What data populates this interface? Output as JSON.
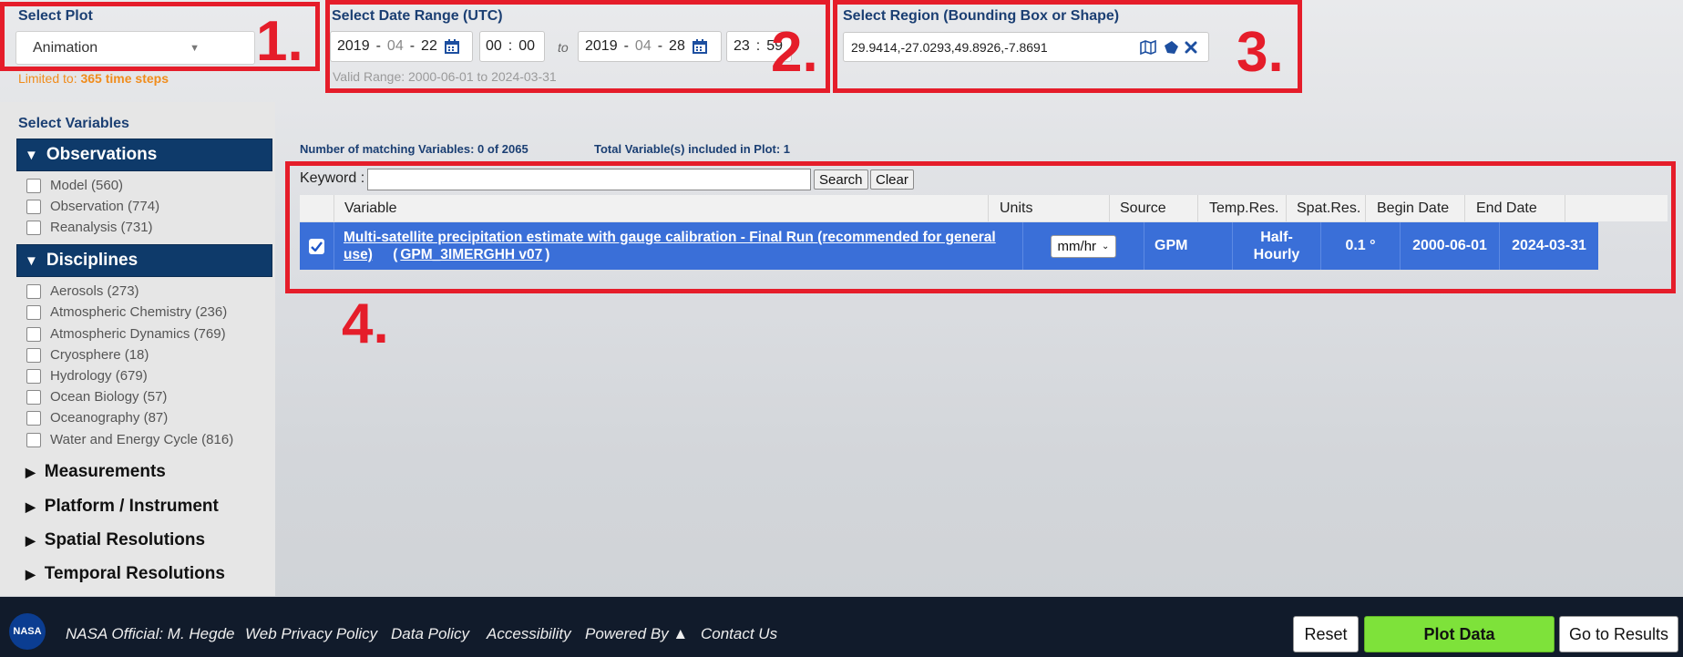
{
  "plot": {
    "section_title": "Select Plot",
    "selected": "Animation",
    "limit_prefix": "Limited to: ",
    "limit_value": "365 time steps"
  },
  "date_range": {
    "section_title": "Select Date Range (UTC)",
    "start_year": "2019",
    "start_month": "04",
    "start_day": "22",
    "start_hour": "00",
    "start_min": "00",
    "to_label": "to",
    "end_year": "2019",
    "end_month": "04",
    "end_day": "28",
    "end_hour": "23",
    "end_min": "59",
    "valid_range": "Valid Range: 2000-06-01 to 2024-03-31"
  },
  "region": {
    "section_title": "Select Region (Bounding Box or Shape)",
    "value": "29.9414,-27.0293,49.8926,-7.8691"
  },
  "annotations": {
    "n1": "1.",
    "n2": "2.",
    "n3": "3.",
    "n4": "4."
  },
  "variables": {
    "section_title": "Select Variables",
    "observations": {
      "header": "Observations",
      "items": [
        "Model (560)",
        "Observation (774)",
        "Reanalysis (731)"
      ]
    },
    "disciplines": {
      "header": "Disciplines",
      "items": [
        "Aerosols (273)",
        "Atmospheric Chemistry (236)",
        "Atmospheric Dynamics (769)",
        "Cryosphere (18)",
        "Hydrology (679)",
        "Ocean Biology (57)",
        "Oceanography (87)",
        "Water and Energy Cycle (816)"
      ]
    },
    "collapsed": [
      "Measurements",
      "Platform / Instrument",
      "Spatial Resolutions",
      "Temporal Resolutions"
    ]
  },
  "table": {
    "matching": "Number of matching Variables: 0 of 2065",
    "total": "Total Variable(s) included in Plot: 1",
    "keyword_label": "Keyword :",
    "search_btn": "Search",
    "clear_btn": "Clear",
    "columns": [
      "Variable",
      "Units",
      "Source",
      "Temp.Res.",
      "Spat.Res.",
      "Begin Date",
      "End Date"
    ],
    "row": {
      "variable_line1": "Multi-satellite precipitation estimate with gauge calibration - Final Run (recommended for general",
      "variable_line2": "use)",
      "variable_id": "GPM_3IMERGHH v07",
      "units": "mm/hr",
      "source": "GPM",
      "temp_res_1": "Half-",
      "temp_res_2": "Hourly",
      "spat_res": "0.1 °",
      "begin": "2000-06-01",
      "end": "2024-03-31"
    }
  },
  "footer": {
    "logo_text": "NASA",
    "links": [
      "NASA Official: M. Hegde",
      "Web Privacy Policy",
      "Data Policy",
      "Accessibility",
      "Powered By ▲",
      "Contact Us"
    ],
    "reset": "Reset",
    "plot_data": "Plot Data",
    "go_results": "Go to Results"
  },
  "colors": {
    "navy": "#0e3a6a",
    "highlight_row": "#3a6fd8",
    "annotation_red": "#e51d2a",
    "plot_btn": "#7ee23a",
    "limit_orange": "#f08c1c"
  }
}
